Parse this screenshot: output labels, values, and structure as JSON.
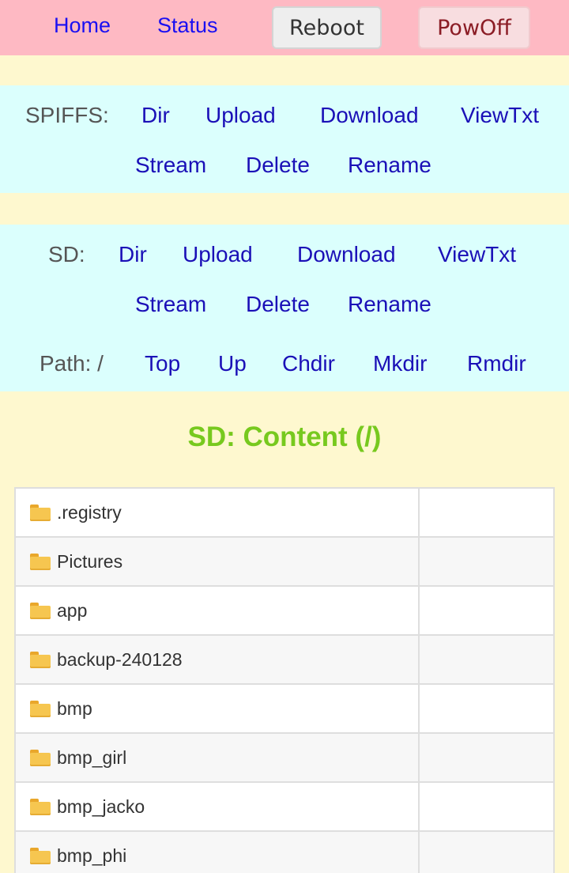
{
  "topbar": {
    "home": "Home",
    "status": "Status",
    "reboot": "Reboot",
    "powoff": "PowOff"
  },
  "spiffs": {
    "label": "SPIFFS:",
    "dir": "Dir",
    "upload": "Upload",
    "download": "Download",
    "viewtxt": "ViewTxt",
    "stream": "Stream",
    "delete": "Delete",
    "rename": "Rename"
  },
  "sd": {
    "label": "SD:",
    "dir": "Dir",
    "upload": "Upload",
    "download": "Download",
    "viewtxt": "ViewTxt",
    "stream": "Stream",
    "delete": "Delete",
    "rename": "Rename",
    "path_label": "Path: /",
    "top": "Top",
    "up": "Up",
    "chdir": "Chdir",
    "mkdir": "Mkdir",
    "rmdir": "Rmdir"
  },
  "content": {
    "heading": "SD: Content (/)",
    "icon": "folder-icon",
    "entries": [
      {
        "name": ".registry",
        "size": ""
      },
      {
        "name": "Pictures",
        "size": ""
      },
      {
        "name": "app",
        "size": ""
      },
      {
        "name": "backup-240128",
        "size": ""
      },
      {
        "name": "bmp",
        "size": ""
      },
      {
        "name": "bmp_girl",
        "size": ""
      },
      {
        "name": "bmp_jacko",
        "size": ""
      },
      {
        "name": "bmp_phi",
        "size": ""
      }
    ]
  }
}
